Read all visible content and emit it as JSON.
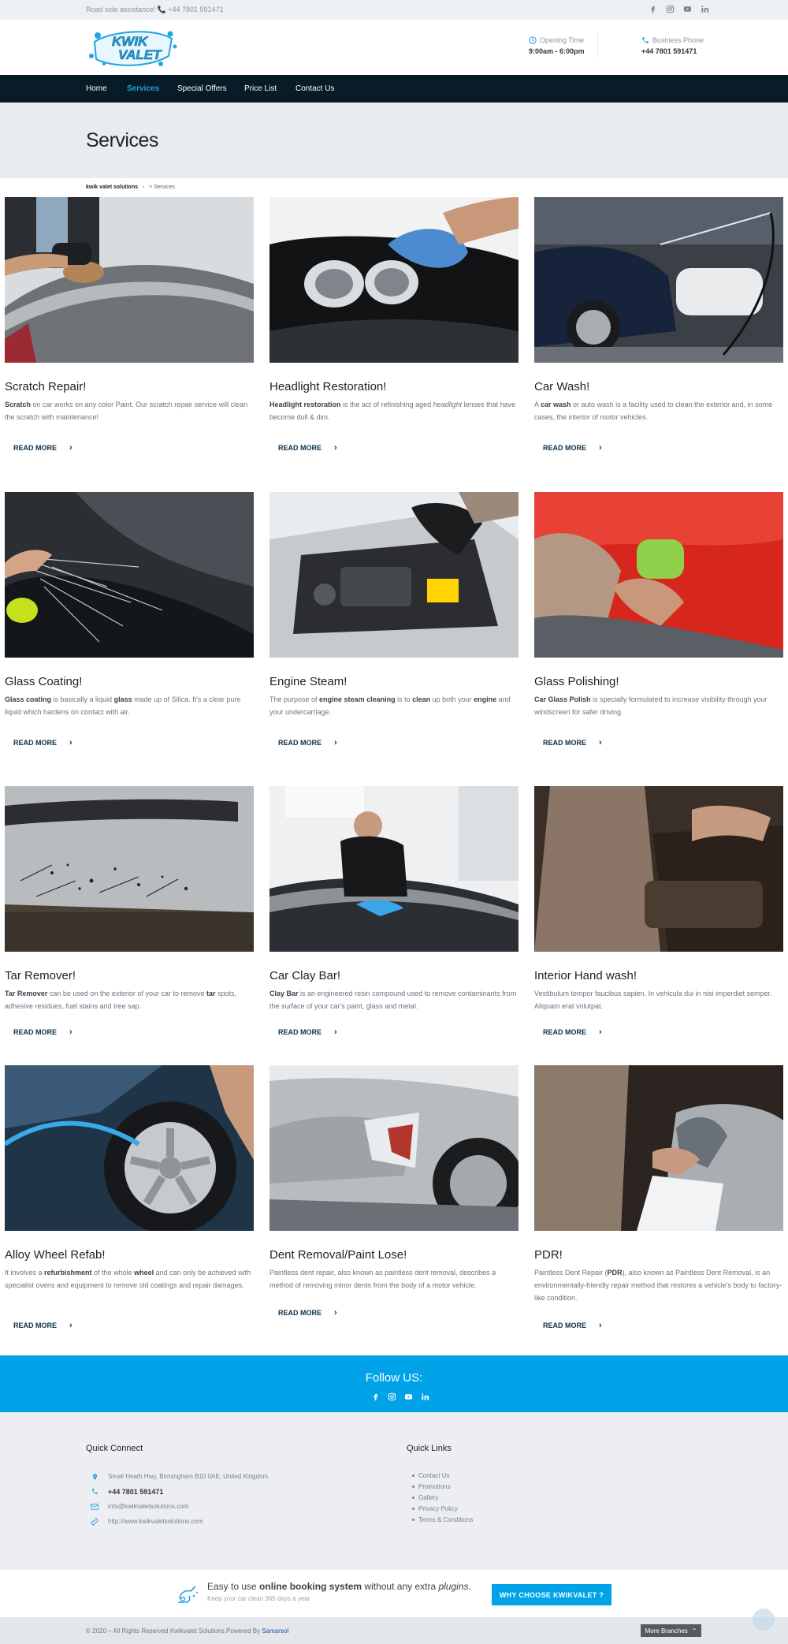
{
  "topbar": {
    "assist_text": "Road side assistance! 📞 +44 7801 591471",
    "socials": [
      "facebook-icon",
      "instagram-icon",
      "youtube-icon",
      "linkedin-icon"
    ]
  },
  "header": {
    "logo_text_line1": "KWIK",
    "logo_text_line2": "VALET",
    "hours_label": "Opening Time",
    "hours_value": "9:00am - 6:00pm",
    "phone_label": "Business Phone",
    "phone_value": "+44 7801 591471"
  },
  "nav": {
    "items": [
      "Home",
      "Services",
      "Special Offers",
      "Price List",
      "Contact Us"
    ],
    "active": "Services"
  },
  "page": {
    "title": "Services",
    "breadcrumb_root": "kwik valet solutions",
    "breadcrumb_sep": "›",
    "breadcrumb_current": "> Services"
  },
  "read_more": "READ MORE",
  "services": [
    {
      "title": "Scratch Repair!",
      "desc": "<b>Scratch</b> on car works on any color Paint. Our scratch repair service will clean the scratch with maintenance!"
    },
    {
      "title": "Headlight Restoration!",
      "desc": "<b>Headlight restoration</b>  is the act of refinishing aged <i>headlight</i> lenses that have become dull &amp; dim."
    },
    {
      "title": "Car Wash!",
      "desc": "A <b>car wash</b> or auto wash is a facility used to clean the exterior and, in some cases, the interior of motor vehicles."
    },
    {
      "title": "Glass Coating!",
      "desc": "<b>Glass coating</b> is basically a liquid <b>glass</b> made up of Silica. It's a clear pure liquid which hardens  on contact with air."
    },
    {
      "title": "Engine Steam!",
      "desc": "The purpose of <b>engine steam cleaning</b> is to <b>clean</b> up both your <b>engine</b> and your undercarriage."
    },
    {
      "title": "Glass Polishing!",
      "desc": "<b>Car Glass Polish</b> is specially formulated to increase visibility through your windscreen for safer driving."
    },
    {
      "title": "Tar Remover!",
      "desc": "<b>Tar Remover</b> can be used on the exterior of your car to remove <b>tar</b> spots, adhesive residues, fuel stains and tree sap."
    },
    {
      "title": "Car Clay Bar!",
      "desc": "<b>Clay Bar</b> is an engineered resin compound used to remove contaminants from the surface of your car's paint, glass and metal."
    },
    {
      "title": "Interior Hand wash!",
      "desc": "Vestibulum tempor faucibus sapien. In vehicula dui in nisi imperdiet semper. Aliquam erat volutpat."
    },
    {
      "title": "Alloy Wheel Refab!",
      "desc": "It involves a <b>refurbishment</b> of the whole <b>wheel</b> and can only be achieved with specialist ovens and equipment to remove old coatings and repair damages."
    },
    {
      "title": "Dent Removal/Paint Lose!",
      "desc": "Paintless dent repair, also known as paintless dent removal, describes a method of removing minor dents from the body of a motor vehicle."
    },
    {
      "title": "PDR!",
      "desc": "Paintless Dent Repair (<b>PDR</b>), also known as Paintless Dent Removal, is an environmentally-friendly repair method that restores a vehicle's body to factory-like condition."
    }
  ],
  "follow": {
    "title": "Follow US:"
  },
  "footer": {
    "quick_connect_title": "Quick Connect",
    "address": "Small Heath Hwy, Birmingham B10 0AE, United Kingdom",
    "phone": "+44 7801 591471",
    "email": "info@kwikvaletsolutions.com",
    "website": "http://www.kwikvaletsolutions.com",
    "quick_links_title": "Quick Links",
    "links": [
      "Contact Us",
      "Promotions",
      "Gallery",
      "Privacy Policy",
      "Terms & Conditions"
    ]
  },
  "booking": {
    "text_pre": "Easy to use ",
    "text_bold": "online booking system",
    "text_mid": " without any extra ",
    "text_italic": "plugins.",
    "sub": "Keep your car clean 365 days a year",
    "cta": "WHY CHOOSE KWIKVALET ?"
  },
  "copyright": {
    "text": "© 2020 – All Rights Reserved Kwikvalet Solutions.Powered By ",
    "link": "Samarsol",
    "branches": "More Branches",
    "branches_icon": "chevron-up-icon"
  },
  "colors": {
    "accent": "#00a3e8",
    "nav_bg": "#071c26",
    "active_nav": "#22a3e2",
    "link_dark": "#0d3047"
  }
}
